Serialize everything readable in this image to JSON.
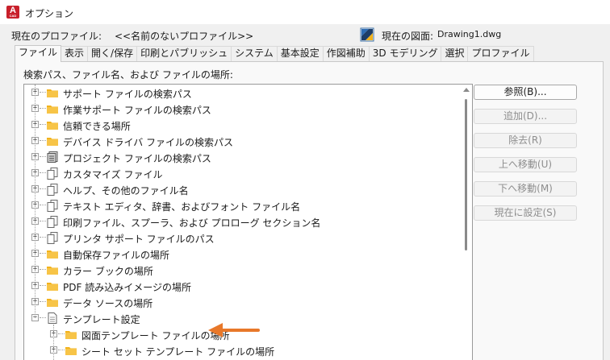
{
  "window": {
    "app_icon_letter": "A",
    "app_icon_sub": "CAD",
    "title": "オプション"
  },
  "profile": {
    "current_profile_label": "現在のプロファイル:",
    "current_profile_value": "<<名前のないプロファイル>>",
    "current_drawing_label": "現在の図面:",
    "current_drawing_value": "Drawing1.dwg"
  },
  "tabs": [
    {
      "label": "ファイル",
      "active": true
    },
    {
      "label": "表示"
    },
    {
      "label": "開く/保存"
    },
    {
      "label": "印刷とパブリッシュ"
    },
    {
      "label": "システム"
    },
    {
      "label": "基本設定"
    },
    {
      "label": "作図補助"
    },
    {
      "label": "3D モデリング"
    },
    {
      "label": "選択"
    },
    {
      "label": "プロファイル"
    }
  ],
  "panel": {
    "tree_label": "検索パス、ファイル名、および ファイルの場所:"
  },
  "tree": {
    "items": [
      {
        "label": "サポート ファイルの検索パス",
        "icon": "folder-icon",
        "expander": "+"
      },
      {
        "label": "作業サポート ファイルの検索パス",
        "icon": "folder-icon",
        "expander": "+"
      },
      {
        "label": "信頼できる場所",
        "icon": "folder-icon",
        "expander": "+"
      },
      {
        "label": "デバイス ドライバ ファイルの検索パス",
        "icon": "folder-icon",
        "expander": "+"
      },
      {
        "label": "プロジェクト ファイルの検索パス",
        "icon": "stack-icon",
        "expander": "+"
      },
      {
        "label": "カスタマイズ ファイル",
        "icon": "files-icon",
        "expander": "+"
      },
      {
        "label": "ヘルプ、その他のファイル名",
        "icon": "files-icon",
        "expander": "+"
      },
      {
        "label": "テキスト エディタ、辞書、およびフォント ファイル名",
        "icon": "files-icon",
        "expander": "+"
      },
      {
        "label": "印刷ファイル、スプーラ、および プロローグ セクション名",
        "icon": "files-icon",
        "expander": "+"
      },
      {
        "label": "プリンタ サポート ファイルのパス",
        "icon": "files-icon",
        "expander": "+"
      },
      {
        "label": "自動保存ファイルの場所",
        "icon": "folder-icon",
        "expander": "+"
      },
      {
        "label": "カラー ブックの場所",
        "icon": "folder-icon",
        "expander": "+"
      },
      {
        "label": "PDF 読み込みイメージの場所",
        "icon": "folder-icon",
        "expander": "+"
      },
      {
        "label": "データ ソースの場所",
        "icon": "folder-icon",
        "expander": "+"
      },
      {
        "label": "テンプレート設定",
        "icon": "document-icon",
        "expander": "−"
      },
      {
        "label": "図面テンプレート ファイルの場所",
        "icon": "folder-icon",
        "expander": "+"
      },
      {
        "label": "シート セット テンプレート ファイルの場所",
        "icon": "folder-icon",
        "expander": "+"
      }
    ]
  },
  "buttons": {
    "browse": "参照(B)...",
    "add": "追加(D)...",
    "remove": "除去(R)",
    "move_up": "上へ移動(U)",
    "move_down": "下へ移動(M)",
    "set_current": "現在に設定(S)"
  },
  "colors": {
    "folder": "#f2b21c",
    "arrow": "#e8782a",
    "app_icon": "#c8202b"
  }
}
